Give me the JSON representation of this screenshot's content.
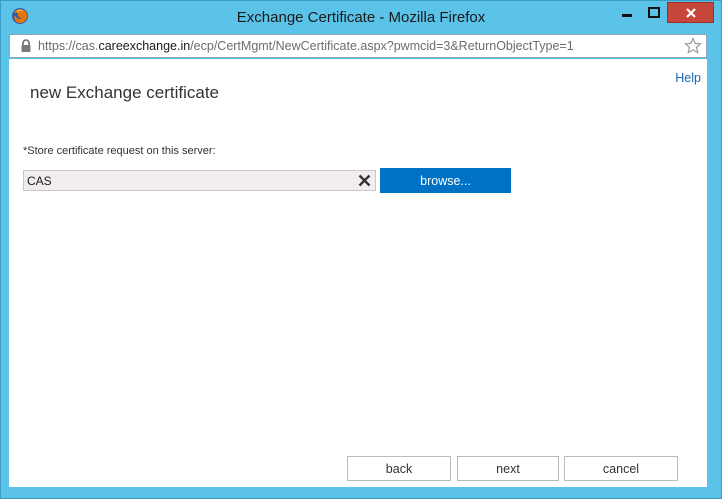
{
  "window": {
    "title": "Exchange Certificate - Mozilla Firefox",
    "titlebar_color": "#5bc2e8",
    "close_button_color": "#c7463c",
    "icons": [
      "firefox-icon",
      "minimize-icon",
      "maximize-icon",
      "close-icon"
    ]
  },
  "address": {
    "url_prefix": "https://cas.",
    "url_host": "careexchange.in",
    "url_path": "/ecp/CertMgmt/NewCertificate.aspx?pwmcid=3&ReturnObjectType=1",
    "icons": [
      "lock-icon",
      "bookmark-star-icon"
    ]
  },
  "page": {
    "help_label": "Help",
    "title": "new Exchange certificate",
    "field_label": "*Store certificate request on this server:",
    "field_value": "CAS",
    "browse_label": "browse...",
    "accent_color": "#0072c6",
    "help_link_color": "#1565b0"
  },
  "footer": {
    "back_label": "back",
    "next_label": "next",
    "cancel_label": "cancel"
  }
}
